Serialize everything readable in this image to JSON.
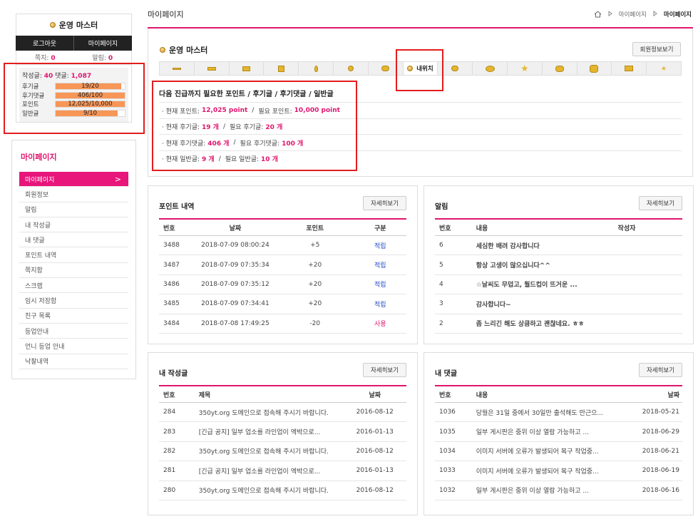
{
  "profile": {
    "username": "운영 마스터",
    "logout": "로그아웃",
    "mypage": "마이페이지",
    "memo_label": "쪽지:",
    "memo_count": "0",
    "alarm_label": "알림:",
    "alarm_count": "0",
    "posts_label": "작성글:",
    "posts_count": "40",
    "comments_label": "댓글:",
    "comments_count": "1,087",
    "stats": [
      {
        "label": "후기글",
        "value": "19/20",
        "fill": 0.95
      },
      {
        "label": "후기댓글",
        "value": "406/100",
        "fill": 1.0
      },
      {
        "label": "포인트",
        "value": "12,025/10,000",
        "fill": 1.0
      },
      {
        "label": "일반글",
        "value": "9/10",
        "fill": 0.9
      }
    ]
  },
  "menu": {
    "title": "마이페이지",
    "items": [
      "마이페이지",
      "회원정보",
      "알림",
      "내 작성글",
      "내 댓글",
      "포인트 내역",
      "쪽지함",
      "스크랩",
      "임시 저장함",
      "친구 목록",
      "등업안내",
      "언니 등업 안내",
      "낙찰내역"
    ],
    "active_arrow": ">"
  },
  "header": {
    "title": "마이페이지",
    "crumb": [
      "마이페이지",
      "마이페이지"
    ]
  },
  "info": {
    "username": "운영 마스터",
    "member_btn": "회원정보보기",
    "my_rank_tab": "내위치",
    "heading": "다음 진급까지 필요한 포인트 / 후기글 / 후기댓글 / 일반글",
    "rows": [
      {
        "a": "· 현재 포인트:",
        "av": "12,025 point",
        "b": "필요 포인트:",
        "bv": "10,000 point"
      },
      {
        "a": "· 현재 후기글:",
        "av": "19 개",
        "b": "필요 후기글:",
        "bv": "20 개"
      },
      {
        "a": "· 현재 후기댓글:",
        "av": "406 개",
        "b": "필요 후기댓글:",
        "bv": "100 개"
      },
      {
        "a": "· 현재 일반글:",
        "av": "9 개",
        "b": "필요 일반글:",
        "bv": "10 개"
      }
    ]
  },
  "more_label": "자세히보기",
  "points": {
    "title": "포인트 내역",
    "headers": [
      "번호",
      "날짜",
      "포인트",
      "구분"
    ],
    "rows": [
      [
        "3488",
        "2018-07-09 08:00:24",
        "+5",
        "적립"
      ],
      [
        "3487",
        "2018-07-09 07:35:34",
        "+20",
        "적립"
      ],
      [
        "3486",
        "2018-07-09 07:35:12",
        "+20",
        "적립"
      ],
      [
        "3485",
        "2018-07-09 07:34:41",
        "+20",
        "적립"
      ],
      [
        "3484",
        "2018-07-08 17:49:25",
        "-20",
        "사용"
      ]
    ]
  },
  "alarms": {
    "title": "알림",
    "headers": [
      "번호",
      "내용",
      "작성자"
    ],
    "rows": [
      [
        "6",
        "세심한 배려 감사합니다",
        ""
      ],
      [
        "5",
        "항상 고생이 많으십니다^^",
        ""
      ],
      [
        "4",
        "☆날씨도 무덥고, 월드컵이 뜨거운 ...",
        ""
      ],
      [
        "3",
        "감사합니다~",
        ""
      ],
      [
        "2",
        "좀 느리긴 해도 상큼하고 괜찮네요. ㅎㅎ",
        ""
      ]
    ]
  },
  "myposts": {
    "title": "내 작성글",
    "headers": [
      "번호",
      "제목",
      "날짜"
    ],
    "rows": [
      [
        "284",
        "350yt.org 도메인으로 접속해 주시기 바랍니다.",
        "2016-08-12"
      ],
      [
        "283",
        "[긴급 공지] 일부 업소를 라인업이 엑박으로...",
        "2016-01-13"
      ],
      [
        "282",
        "350yt.org 도메인으로 접속해 주시기 바랍니다.",
        "2016-08-12"
      ],
      [
        "281",
        "[긴급 공지] 일부 업소를 라인업이 엑박으로...",
        "2016-01-13"
      ],
      [
        "280",
        "350yt.org 도메인으로 접속해 주시기 바랍니다.",
        "2016-08-12"
      ]
    ]
  },
  "mycomments": {
    "title": "내 댓글",
    "headers": [
      "번호",
      "내용",
      "날짜"
    ],
    "rows": [
      [
        "1036",
        "당월은 31일 중에서 30일만 출석해도 만근으...",
        "2018-05-21"
      ],
      [
        "1035",
        "일부 게시판은 중위 이상 열람 가능하고 ...",
        "2018-06-29"
      ],
      [
        "1034",
        "이미지 서버에 오류가 발생되어 복구 작업중...",
        "2018-06-21"
      ],
      [
        "1033",
        "이미지 서버에 오류가 발생되어 복구 작업중...",
        "2018-06-19"
      ],
      [
        "1032",
        "일부 게시판은 중위 이상 열람 가능하고 ...",
        "2018-06-16"
      ]
    ]
  }
}
